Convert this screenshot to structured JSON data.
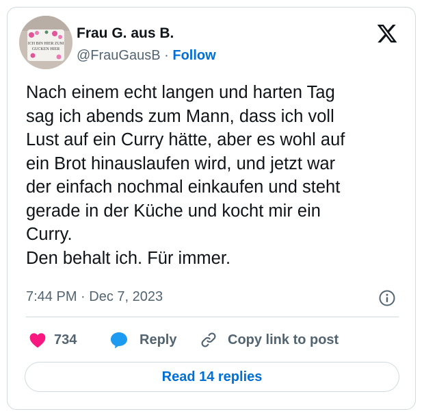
{
  "author": {
    "name": "Frau G. aus B.",
    "handle": "@FrauGausB",
    "separator": "·",
    "follow_label": "Follow"
  },
  "avatar": {
    "mug_text_1": "ICH BIN HIER ZUM",
    "mug_text_2": "GUCKEN HIER"
  },
  "tweet": {
    "text": "Nach einem echt langen und harten Tag\nsag ich abends zum Mann, dass ich voll\nLust auf ein Curry hätte, aber es wohl auf\nein Brot hinauslaufen wird, und jetzt war\nder einfach nochmal einkaufen und steht\ngerade in der Küche und kocht mir ein\nCurry.\nDen behalt ich. Für immer.",
    "timestamp": "7:44 PM · Dec 7, 2023"
  },
  "actions": {
    "like_count": "734",
    "reply_label": "Reply",
    "copy_label": "Copy link to post"
  },
  "read_replies_label": "Read 14 replies",
  "colors": {
    "accent": "#006fd6",
    "like": "#f91880",
    "reply": "#1d9bf0",
    "muted": "#536471",
    "border": "#cfd9de"
  }
}
